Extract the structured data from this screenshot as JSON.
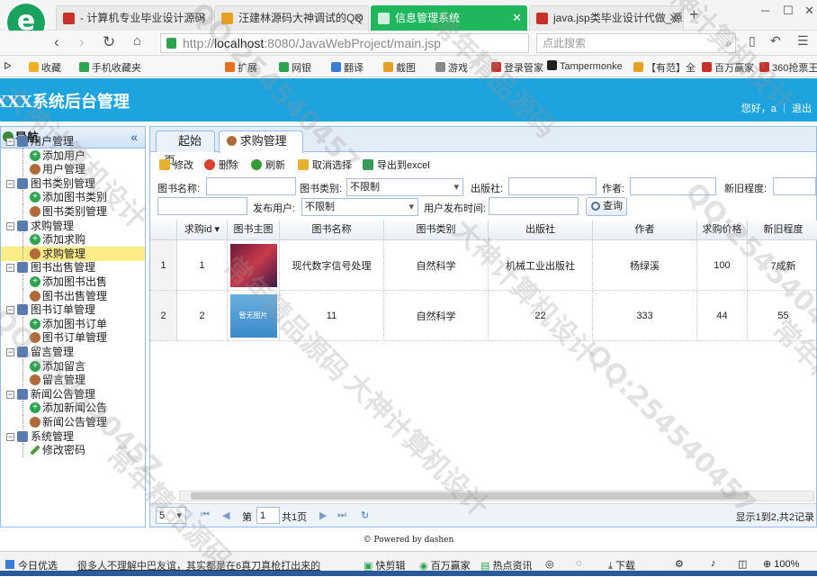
{
  "browser": {
    "tabs": [
      {
        "label": "- 计算机专业毕业设计源码",
        "color": "#c8302a"
      },
      {
        "label": "汪建林源码大神调试的QQ",
        "color": "#e8a020"
      },
      {
        "label": "信息管理系统",
        "color": "#ffffff"
      },
      {
        "label": "java.jsp类毕业设计代做_源",
        "color": "#c8302a"
      }
    ],
    "url_prefix": "http://",
    "url_host": "localhost",
    "url_rest": ":8080/JavaWebProject/main.jsp",
    "search_placeholder": "点此搜索",
    "favorites": [
      "收藏",
      "手机收藏夹",
      "扩展",
      "网银",
      "翻译",
      "截图",
      "游戏",
      "登录管家",
      "Tampermonke",
      "【有范】全",
      "百万赢家",
      "360抢票王"
    ]
  },
  "app": {
    "title": "XXX系统后台管理",
    "user_text": "您好，a ｜ 退出",
    "accent": "#1da3de"
  },
  "sidebar": {
    "title": "导航",
    "collapse": "«",
    "tree": [
      {
        "label": "用户管理",
        "level": 0
      },
      {
        "label": "添加用户",
        "level": 1,
        "icon": "add"
      },
      {
        "label": "用户管理",
        "level": 1,
        "icon": "user"
      },
      {
        "label": "图书类别管理",
        "level": 0
      },
      {
        "label": "添加图书类别",
        "level": 1,
        "icon": "add"
      },
      {
        "label": "图书类别管理",
        "level": 1,
        "icon": "user"
      },
      {
        "label": "求购管理",
        "level": 0
      },
      {
        "label": "添加求购",
        "level": 1,
        "icon": "add"
      },
      {
        "label": "求购管理",
        "level": 1,
        "icon": "user",
        "selected": true
      },
      {
        "label": "图书出售管理",
        "level": 0
      },
      {
        "label": "添加图书出售",
        "level": 1,
        "icon": "add"
      },
      {
        "label": "图书出售管理",
        "level": 1,
        "icon": "user"
      },
      {
        "label": "图书订单管理",
        "level": 0
      },
      {
        "label": "添加图书订单",
        "level": 1,
        "icon": "add"
      },
      {
        "label": "图书订单管理",
        "level": 1,
        "icon": "user"
      },
      {
        "label": "留言管理",
        "level": 0
      },
      {
        "label": "添加留言",
        "level": 1,
        "icon": "add"
      },
      {
        "label": "留言管理",
        "level": 1,
        "icon": "user"
      },
      {
        "label": "新闻公告管理",
        "level": 0
      },
      {
        "label": "添加新闻公告",
        "level": 1,
        "icon": "add"
      },
      {
        "label": "新闻公告管理",
        "level": 1,
        "icon": "user"
      },
      {
        "label": "系统管理",
        "level": 0
      },
      {
        "label": "修改密码",
        "level": 1,
        "icon": "pen"
      }
    ]
  },
  "main": {
    "tabs": [
      {
        "label": "起始页"
      },
      {
        "label": "求购管理",
        "closable": "×"
      }
    ],
    "toolbar": {
      "edit": "修改",
      "delete": "删除",
      "refresh": "刷新",
      "deselect": "取消选择",
      "export": "导出到excel"
    },
    "filters": {
      "book_name_label": "图书名称:",
      "category_label": "图书类别:",
      "category_value": "不限制",
      "publisher_label": "出版社:",
      "author_label": "作者:",
      "condition_label": "新旧程度:",
      "user_label": "发布用户:",
      "user_value": "不限制",
      "time_label": "用户发布时间:",
      "query_button": "查询"
    },
    "columns": [
      "求购id",
      "图书主图",
      "图书名称",
      "图书类别",
      "出版社",
      "作者",
      "求购价格",
      "新旧程度"
    ],
    "rows": [
      {
        "rownum": "1",
        "id": "1",
        "image": "book-cover-1",
        "name": "现代数字信号处理",
        "category": "自然科学",
        "publisher": "机械工业出版社",
        "author": "杨绿溪",
        "price": "100",
        "condition": "7成新"
      },
      {
        "rownum": "2",
        "id": "2",
        "image": "placeholder",
        "image_text": "暂无图片",
        "name": "11",
        "category": "自然科学",
        "publisher": "22",
        "author": "333",
        "price": "44",
        "condition": "55"
      }
    ],
    "pager": {
      "page_size": "5",
      "page_label_pre": "第",
      "page_value": "1",
      "page_label_post": "共1页",
      "summary": "显示1到2,共2记录"
    }
  },
  "footer": "© Powered by dashen",
  "status_bar": {
    "left": "今日优选",
    "news": "很多人不理解中巴友谊，其实都是在6真刀真枪打出来的",
    "items": [
      "快剪辑",
      "百万赢家",
      "热点资讯",
      "下载",
      "100%"
    ]
  },
  "watermarks": [
    "大神计算机设计",
    "QQ:254540457",
    "常年精品源码"
  ]
}
